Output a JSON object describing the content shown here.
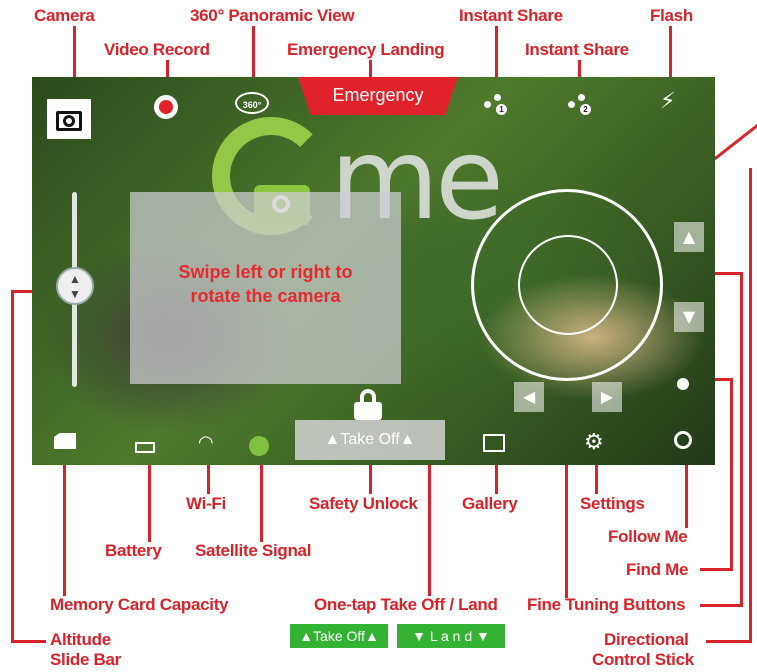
{
  "callouts": {
    "camera": "Camera",
    "panoramic": "360° Panoramic View",
    "instant_share_1": "Instant Share",
    "flash": "Flash",
    "video_record": "Video Record",
    "emergency_landing": "Emergency Landing",
    "instant_share_2": "Instant Share",
    "wifi": "Wi-Fi",
    "safety_unlock": "Safety Unlock",
    "gallery": "Gallery",
    "settings": "Settings",
    "follow_me": "Follow Me",
    "battery": "Battery",
    "satellite_signal": "Satellite Signal",
    "find_me": "Find Me",
    "memory_card": "Memory Card Capacity",
    "one_tap": "One-tap Take Off / Land",
    "fine_tuning": "Fine Tuning Buttons",
    "altitude_1": "Altitude",
    "altitude_2": "Slide Bar",
    "directional_1": "Directional",
    "directional_2": "Control Stick"
  },
  "screen": {
    "emergency_label": "Emergency",
    "pano_label": "360°",
    "share_1_num": "1",
    "share_2_num": "2",
    "logo_text": "me",
    "rotate_hint": "Swipe left or right to\nrotate the camera",
    "takeoff_label": "▲Take Off▲"
  },
  "legend": {
    "take_off": "▲Take Off▲",
    "land": "▼ L a n d ▼",
    "color": "#34b233"
  },
  "colors": {
    "callout": "#d8232a",
    "emergency": "#e0232b",
    "logo_green": "#8cc63f"
  }
}
